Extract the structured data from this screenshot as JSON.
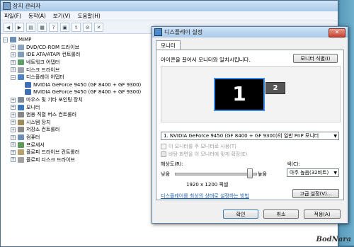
{
  "device_manager": {
    "title": "장치 관리자",
    "menu": [
      "파일(F)",
      "동작(A)",
      "보기(V)",
      "도움말(H)"
    ],
    "root": "MIMP",
    "nodes": [
      {
        "label": "DVD/CD-ROM 드라이브",
        "expanded": false
      },
      {
        "label": "IDE ATA/ATAPI 컨트롤러",
        "expanded": false
      },
      {
        "label": "네트워크 어댑터",
        "expanded": false
      },
      {
        "label": "디스크 드라이브",
        "expanded": false
      },
      {
        "label": "디스플레이 어댑터",
        "expanded": true,
        "children": [
          "NVIDIA GeForce 9450 (GF 8400 + GF 9300)",
          "NVIDIA GeForce 9450 (GF 8400 + GF 9300)"
        ]
      },
      {
        "label": "마우스 및 기타 포인팅 장치",
        "expanded": false
      },
      {
        "label": "모니터",
        "expanded": false
      },
      {
        "label": "범용 직렬 버스 컨트롤러",
        "expanded": false
      },
      {
        "label": "시스템 장치",
        "expanded": false
      },
      {
        "label": "저장소 컨트롤러",
        "expanded": false
      },
      {
        "label": "컴퓨터",
        "expanded": false
      },
      {
        "label": "프로세서",
        "expanded": false
      },
      {
        "label": "플로피 드라이브 컨트롤러",
        "expanded": false
      },
      {
        "label": "플로피 디스크 드라이브",
        "expanded": false
      }
    ]
  },
  "display_settings": {
    "title": "디스플레이 설정",
    "tab": "모니터",
    "instruction": "아이콘을 끌어서 모니터와 일치시킵니다.",
    "identify_button": "모니터 식별(I)",
    "monitor_primary": "1",
    "monitor_secondary": "2",
    "monitor_select": "1. NVIDIA GeForce 9450 (GF 8400 + GF 9300)의 일반 PnP 모니터",
    "check_primary": "이 모니터를 주 모니터로 사용(T)",
    "check_extend": "바탕 화면을 이 모니터에 맞게 확장(E)",
    "resolution_label": "해상도(R):",
    "slider_low": "낮음",
    "slider_high": "높음",
    "resolution_value": "1920 x 1200 픽셀",
    "color_label": "색(C):",
    "color_value": "아주 높음(32비트)",
    "help_link": "디스플레이를 최상의 상태로 설정하는 방법",
    "advanced_button": "고급 설정(V)...",
    "ok_button": "확인",
    "cancel_button": "취소",
    "apply_button": "적용(A)"
  },
  "watermark": "BodNara"
}
